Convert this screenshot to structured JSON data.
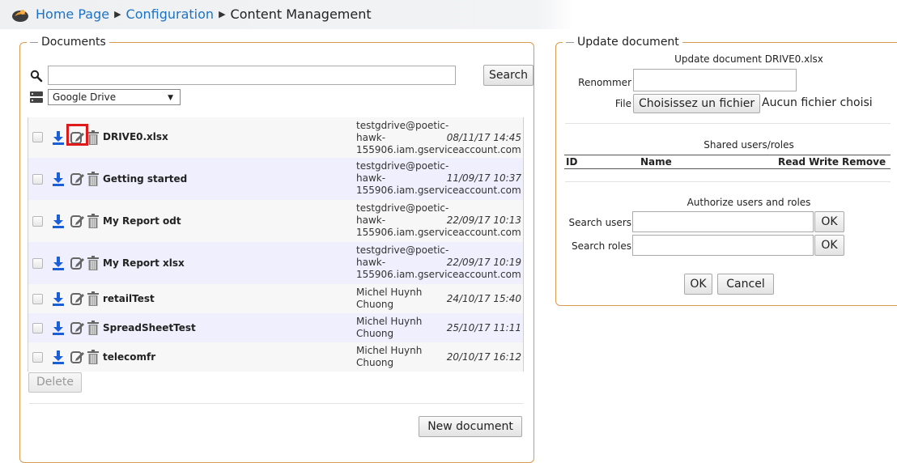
{
  "breadcrumb": {
    "home": "Home Page",
    "config": "Configuration",
    "current": "Content Management"
  },
  "documents": {
    "legend": "Documents",
    "search_value": "",
    "search_button": "Search",
    "source_select": "Google Drive",
    "rows": [
      {
        "name": "DRIVE0.xlsx",
        "owner_lines": [
          "testgdrive@poetic-",
          "hawk-",
          "155906.iam.gserviceaccount.com"
        ],
        "date": "08/11/17 14:45"
      },
      {
        "name": "Getting started",
        "owner_lines": [
          "testgdrive@poetic-",
          "hawk-",
          "155906.iam.gserviceaccount.com"
        ],
        "date": "11/09/17 10:37"
      },
      {
        "name": "My Report odt",
        "owner_lines": [
          "testgdrive@poetic-",
          "hawk-",
          "155906.iam.gserviceaccount.com"
        ],
        "date": "22/09/17 10:13"
      },
      {
        "name": "My Report xlsx",
        "owner_lines": [
          "testgdrive@poetic-",
          "hawk-",
          "155906.iam.gserviceaccount.com"
        ],
        "date": "22/09/17 10:19"
      },
      {
        "name": "retailTest",
        "owner_lines": [
          "Michel Huynh",
          "Chuong"
        ],
        "date": "24/10/17 15:40"
      },
      {
        "name": "SpreadSheetTest",
        "owner_lines": [
          "Michel Huynh",
          "Chuong"
        ],
        "date": "25/10/17 11:11"
      },
      {
        "name": "telecomfr",
        "owner_lines": [
          "Michel Huynh",
          "Chuong"
        ],
        "date": "20/10/17 16:12"
      }
    ],
    "delete_button": "Delete",
    "new_document_button": "New document"
  },
  "update": {
    "legend": "Update document",
    "title": "Update document DRIVE0.xlsx",
    "rename_label": "Renommer",
    "rename_value": "",
    "file_label": "File",
    "file_button": "Choisissez un fichier",
    "file_status": "Aucun fichier choisi",
    "shared_title": "Shared users/roles",
    "shared_columns": [
      "ID",
      "Name",
      "Read",
      "Write",
      "Remove"
    ],
    "authorize_title": "Authorize users and roles",
    "search_users_label": "Search users",
    "search_roles_label": "Search roles",
    "ok_label": "OK",
    "ok_button": "OK",
    "cancel_button": "Cancel"
  },
  "icons": {
    "download": "download-icon",
    "edit": "edit-icon",
    "trash": "trash-icon",
    "search": "magnifier-icon",
    "server": "server-icon"
  },
  "colors": {
    "link": "#1a73c8",
    "fieldset_border": "#d99a4e",
    "row_even": "#efeffe",
    "row_odd": "#f7f7f7",
    "download_icon": "#1a5fd6",
    "highlight": "#e01a1a"
  }
}
